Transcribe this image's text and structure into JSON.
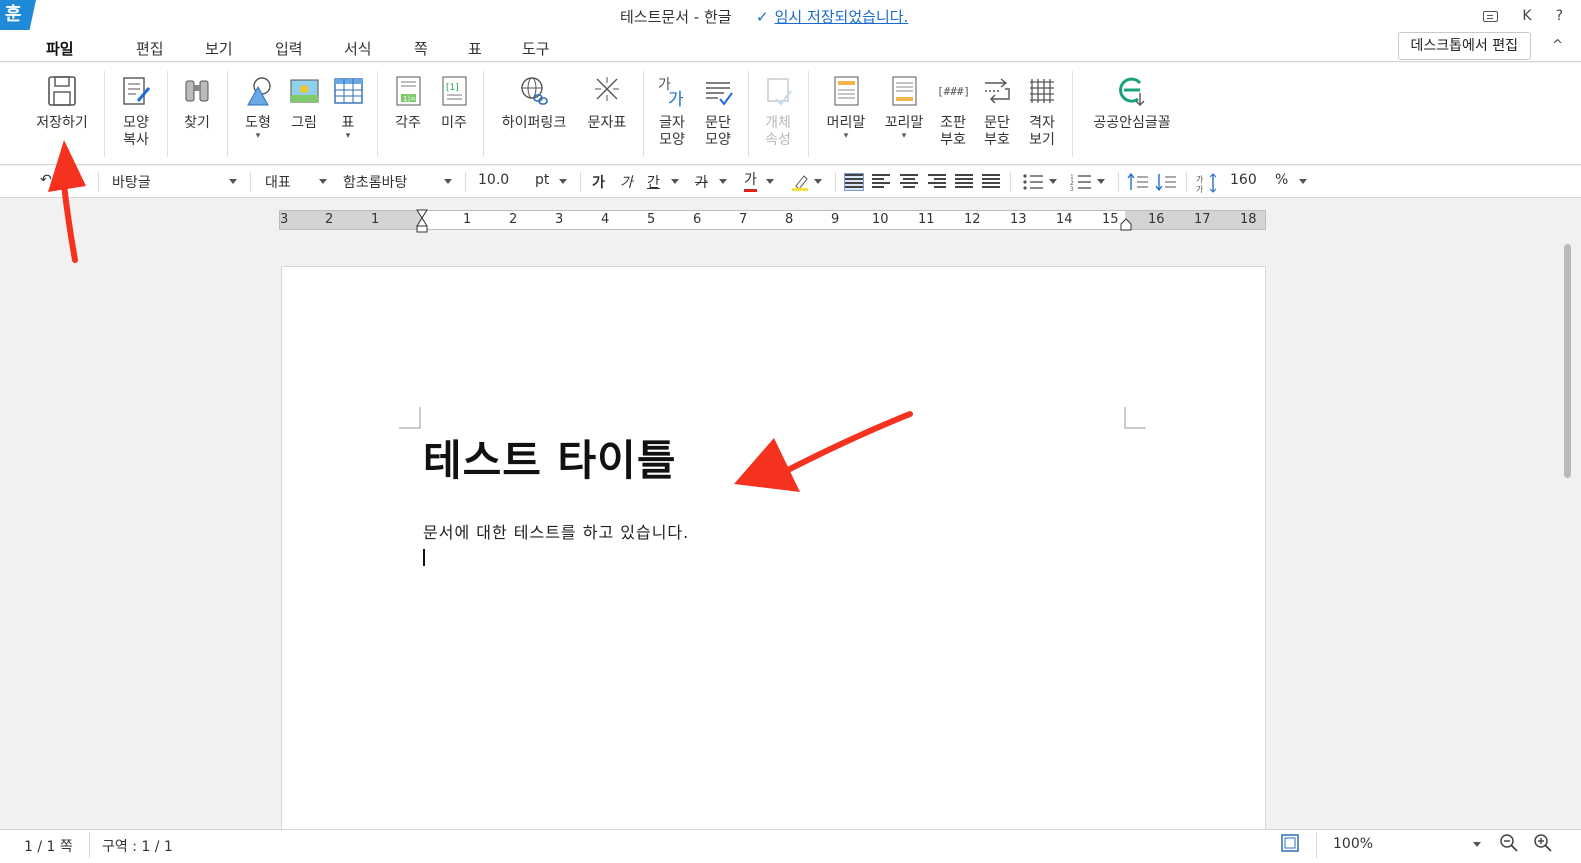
{
  "app": {
    "logo_glyph": "훈",
    "title": "테스트문서 - 한글",
    "save_status_check": "✓",
    "save_status": "임시 저장되었습니다.",
    "top_right": {
      "user_initial": "K",
      "help": "?"
    }
  },
  "menu": {
    "tabs": [
      "파일",
      "편집",
      "보기",
      "입력",
      "서식",
      "쪽",
      "표",
      "도구"
    ],
    "active_tab": "파일",
    "desktop_edit_button": "데스크톱에서 편집",
    "collapse_glyph": "^"
  },
  "ribbon": {
    "save": "저장하기",
    "copy_format_1": "모양",
    "copy_format_2": "복사",
    "find": "찾기",
    "shape": "도형",
    "picture": "그림",
    "table": "표",
    "footnote": "각주",
    "endnote": "미주",
    "hyperlink": "하이퍼링크",
    "char_map": "문자표",
    "char_shape_1": "글자",
    "char_shape_2": "모양",
    "para_shape_1": "문단",
    "para_shape_2": "모양",
    "object_prop_1": "개체",
    "object_prop_2": "속성",
    "header": "머리말",
    "footer": "꼬리말",
    "layout_code_1": "조판",
    "layout_code_2": "부호",
    "para_mark_1": "문단",
    "para_mark_2": "부호",
    "grid_view_1": "격자",
    "grid_view_2": "보기",
    "public_font": "공공안심글꼴",
    "footnote_icon_text": "1)=",
    "endnote_icon_text": "[1]",
    "layout_code_icon_text": "[###]"
  },
  "format_bar": {
    "style": "바탕글",
    "lang": "대표",
    "font": "함초롬바탕",
    "size": "10.0",
    "unit": "pt",
    "bold_glyph": "가",
    "italic_glyph": "가",
    "underline_glyph": "간",
    "strike_glyph": "가",
    "color_glyph": "가",
    "line_spacing": "160",
    "line_spacing_unit": "%",
    "line_spacing_icon_text": "가"
  },
  "ruler": {
    "ticks": [
      "3",
      "2",
      "1",
      "1",
      "2",
      "3",
      "4",
      "5",
      "6",
      "7",
      "8",
      "9",
      "10",
      "11",
      "12",
      "13",
      "14",
      "15",
      "16",
      "17",
      "18"
    ]
  },
  "document": {
    "heading": "테스트 타이틀",
    "body": "문서에 대한 테스트를 하고 있습니다."
  },
  "status": {
    "page": "1 / 1 쪽",
    "section": "구역 : 1 / 1",
    "zoom": "100%"
  },
  "colors": {
    "accent": "#1f8ad8",
    "link": "#1a6bd1",
    "annotation_arrow": "#f4321e"
  }
}
